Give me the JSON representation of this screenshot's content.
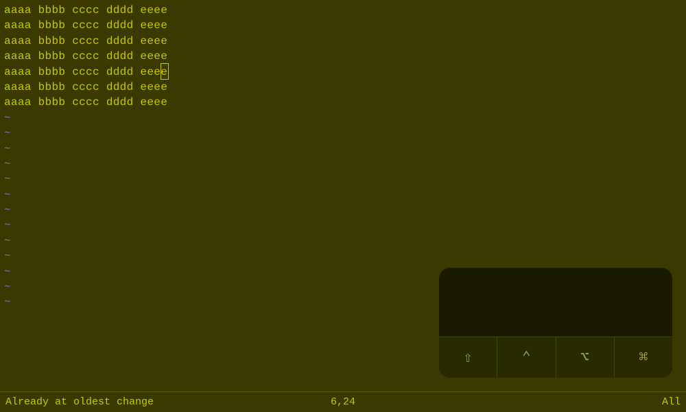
{
  "editor": {
    "lines": [
      {
        "text": "aaaa bbbb cccc dddd eeee",
        "hasCursor": false,
        "cursorPos": -1
      },
      {
        "text": "aaaa bbbb cccc dddd eeee",
        "hasCursor": false,
        "cursorPos": -1
      },
      {
        "text": "aaaa bbbb cccc dddd eeee",
        "hasCursor": false,
        "cursorPos": -1
      },
      {
        "text": "aaaa bbbb cccc dddd eeee",
        "hasCursor": false,
        "cursorPos": -1
      },
      {
        "text": "aaaa bbbb cccc dddd eee",
        "hasCursor": true,
        "cursorPos": 23,
        "cursorChar": "e"
      },
      {
        "text": "aaaa bbbb cccc dddd eeee",
        "hasCursor": false,
        "cursorPos": -1
      },
      {
        "text": "aaaa bbbb cccc dddd eeee",
        "hasCursor": false,
        "cursorPos": -1
      }
    ],
    "tildeCount": 13
  },
  "statusBar": {
    "leftText": "Already at oldest change",
    "position": "6,24",
    "mode": "All"
  },
  "keyboard": {
    "keys": [
      {
        "icon": "⇧",
        "label": "shift-key"
      },
      {
        "icon": "⌃",
        "label": "ctrl-key"
      },
      {
        "icon": "⌥",
        "label": "alt-key"
      },
      {
        "icon": "⌘",
        "label": "cmd-key"
      }
    ]
  }
}
